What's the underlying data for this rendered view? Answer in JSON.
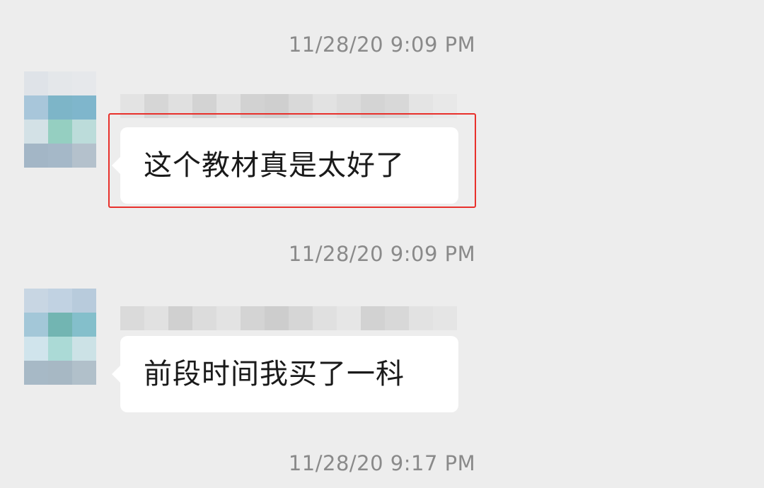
{
  "messages": [
    {
      "timestamp": "11/28/20 9:09 PM",
      "text": "这个教材真是太好了",
      "highlighted": true
    },
    {
      "timestamp": "11/28/20 9:09 PM",
      "text": "前段时间我买了一科",
      "highlighted": false
    }
  ],
  "trailing_timestamp": "11/28/20 9:17 PM",
  "colors": {
    "background": "#ededed",
    "bubble": "#ffffff",
    "timestamp_text": "#8a8a8a",
    "highlight_border": "#e8302b"
  }
}
